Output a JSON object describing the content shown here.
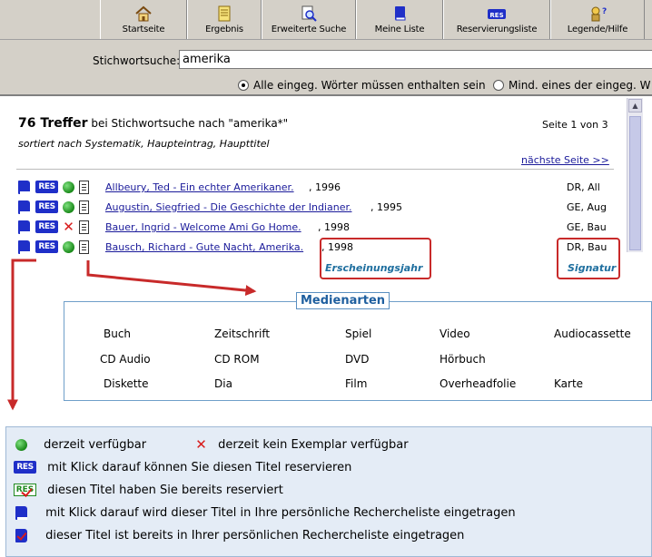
{
  "toolbar": {
    "buttons": [
      {
        "label": "Startseite",
        "icon": "home-icon"
      },
      {
        "label": "Ergebnis",
        "icon": "list-icon"
      },
      {
        "label": "Erweiterte Suche",
        "icon": "magnifier-icon"
      },
      {
        "label": "Meine Liste",
        "icon": "book-icon"
      },
      {
        "label": "Reservierungsliste",
        "icon": "res-icon"
      },
      {
        "label": "Legende/Hilfe",
        "icon": "help-icon"
      }
    ]
  },
  "search": {
    "label": "Stichwortsuche:",
    "value": "amerika",
    "option_all": "Alle eingeg. Wörter müssen enthalten sein",
    "option_any": "Mind. eines der eingeg. W"
  },
  "results": {
    "count": "76 Treffer",
    "query_text": " bei Stichwortsuche nach \"amerika*\"",
    "sort_text": "sortiert nach Systematik, Haupteintrag, Haupttitel",
    "page_info": "Seite 1 von 3",
    "next_page": "nächste Seite >>",
    "res_badge": "RES",
    "rows": [
      {
        "title": "Allbeury, Ted - Ein echter Amerikaner.",
        "year": ", 1996",
        "signature": "DR, All",
        "available": true
      },
      {
        "title": "Augustin, Siegfried - Die Geschichte der Indianer.",
        "year": ", 1995",
        "signature": "GE, Aug",
        "available": true
      },
      {
        "title": "Bauer, Ingrid - Welcome Ami Go Home.",
        "year": ", 1998",
        "signature": "GE, Bau",
        "available": false
      },
      {
        "title": "Bausch, Richard - Gute Nacht, Amerika.",
        "year": ", 1998",
        "signature": "DR, Bau",
        "available": true
      }
    ]
  },
  "annotations": {
    "year_label": "Erscheinungsjahr",
    "signature_label": "Signatur"
  },
  "media": {
    "title": "Medienarten",
    "items": [
      [
        "Buch",
        "Zeitschrift",
        "Spiel",
        "Video",
        "Audiocassette"
      ],
      [
        "CD Audio",
        "CD ROM",
        "DVD",
        "Hörbuch",
        ""
      ],
      [
        "Diskette",
        "Dia",
        "Film",
        "Overheadfolie",
        "Karte"
      ]
    ]
  },
  "legend": {
    "available": "derzeit verfügbar",
    "unavailable": "derzeit kein Exemplar verfügbar",
    "reserve": "mit Klick darauf können Sie diesen Titel reservieren",
    "reserved": "diesen Titel haben Sie bereits reserviert",
    "add_list": "mit Klick darauf wird dieser Titel in Ihre persönliche Rechercheliste eingetragen",
    "in_list": "dieser Titel ist bereits in Ihrer persönlichen Rechercheliste eingetragen"
  },
  "colors": {
    "accent_blue": "#1f2fc8",
    "available_green": "#1a8a1a",
    "unavailable_red": "#d81b1b",
    "callout_red": "#c82a2a"
  }
}
